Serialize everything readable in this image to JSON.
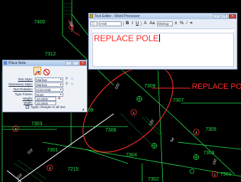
{
  "drawing": {
    "labels": [
      {
        "id": "7400",
        "text": "7400"
      },
      {
        "id": "7312",
        "text": "7312"
      },
      {
        "id": "7303",
        "text": "7303"
      },
      {
        "id": "7308",
        "text": "7308"
      },
      {
        "id": "7309",
        "text": "7309"
      },
      {
        "id": "7307",
        "text": "7307"
      },
      {
        "id": "7306",
        "text": "7306"
      },
      {
        "id": "7305",
        "text": "7305"
      },
      {
        "id": "7304",
        "text": "7304"
      },
      {
        "id": "7301",
        "text": "7301"
      },
      {
        "id": "7301b",
        "text": "7301"
      },
      {
        "id": "7215",
        "text": "7215"
      },
      {
        "id": "7302",
        "text": "7302"
      },
      {
        "id": "7303b",
        "text": "7303"
      }
    ],
    "dims": [
      "123'",
      "125'",
      "54'",
      "141'",
      "110'",
      "110'",
      "110'"
    ],
    "circle_numbers": [
      "4",
      "1",
      "3",
      "4",
      "1"
    ],
    "note_text": "REPLACE POLE"
  },
  "place_note": {
    "title": "Place Note",
    "rows": [
      {
        "key": "Text Style:",
        "value": "Markup",
        "icons": [
          "magnifier-icon",
          "style-picker-icon"
        ]
      },
      {
        "key": "Dimension Style:",
        "value": "Markup",
        "icons": [
          "magnifier-icon",
          "style-picker-icon"
        ]
      },
      {
        "key": "Text Rotation:",
        "value": "Horizontal",
        "icons": []
      },
      {
        "key": "Type Frame:",
        "value": "None",
        "icons": []
      },
      {
        "key": "Height:",
        "value": "10.0000",
        "icons": []
      },
      {
        "key": "Width:",
        "value": "10.0000",
        "icons": []
      }
    ],
    "apply_label": "Apply changes to all text"
  },
  "text_editor": {
    "title": "Text Editor - Word Processor",
    "font_value": "Arial",
    "style_value": "Markup",
    "toolbar_buttons": [
      "B",
      "I",
      "U",
      "A",
      "Aa",
      "±",
      "%"
    ],
    "body_text": "REPLACE POLE"
  },
  "colors": {
    "linework": "#22e04a",
    "markup": "#ff2a2a",
    "highlight": "#ffffff"
  }
}
